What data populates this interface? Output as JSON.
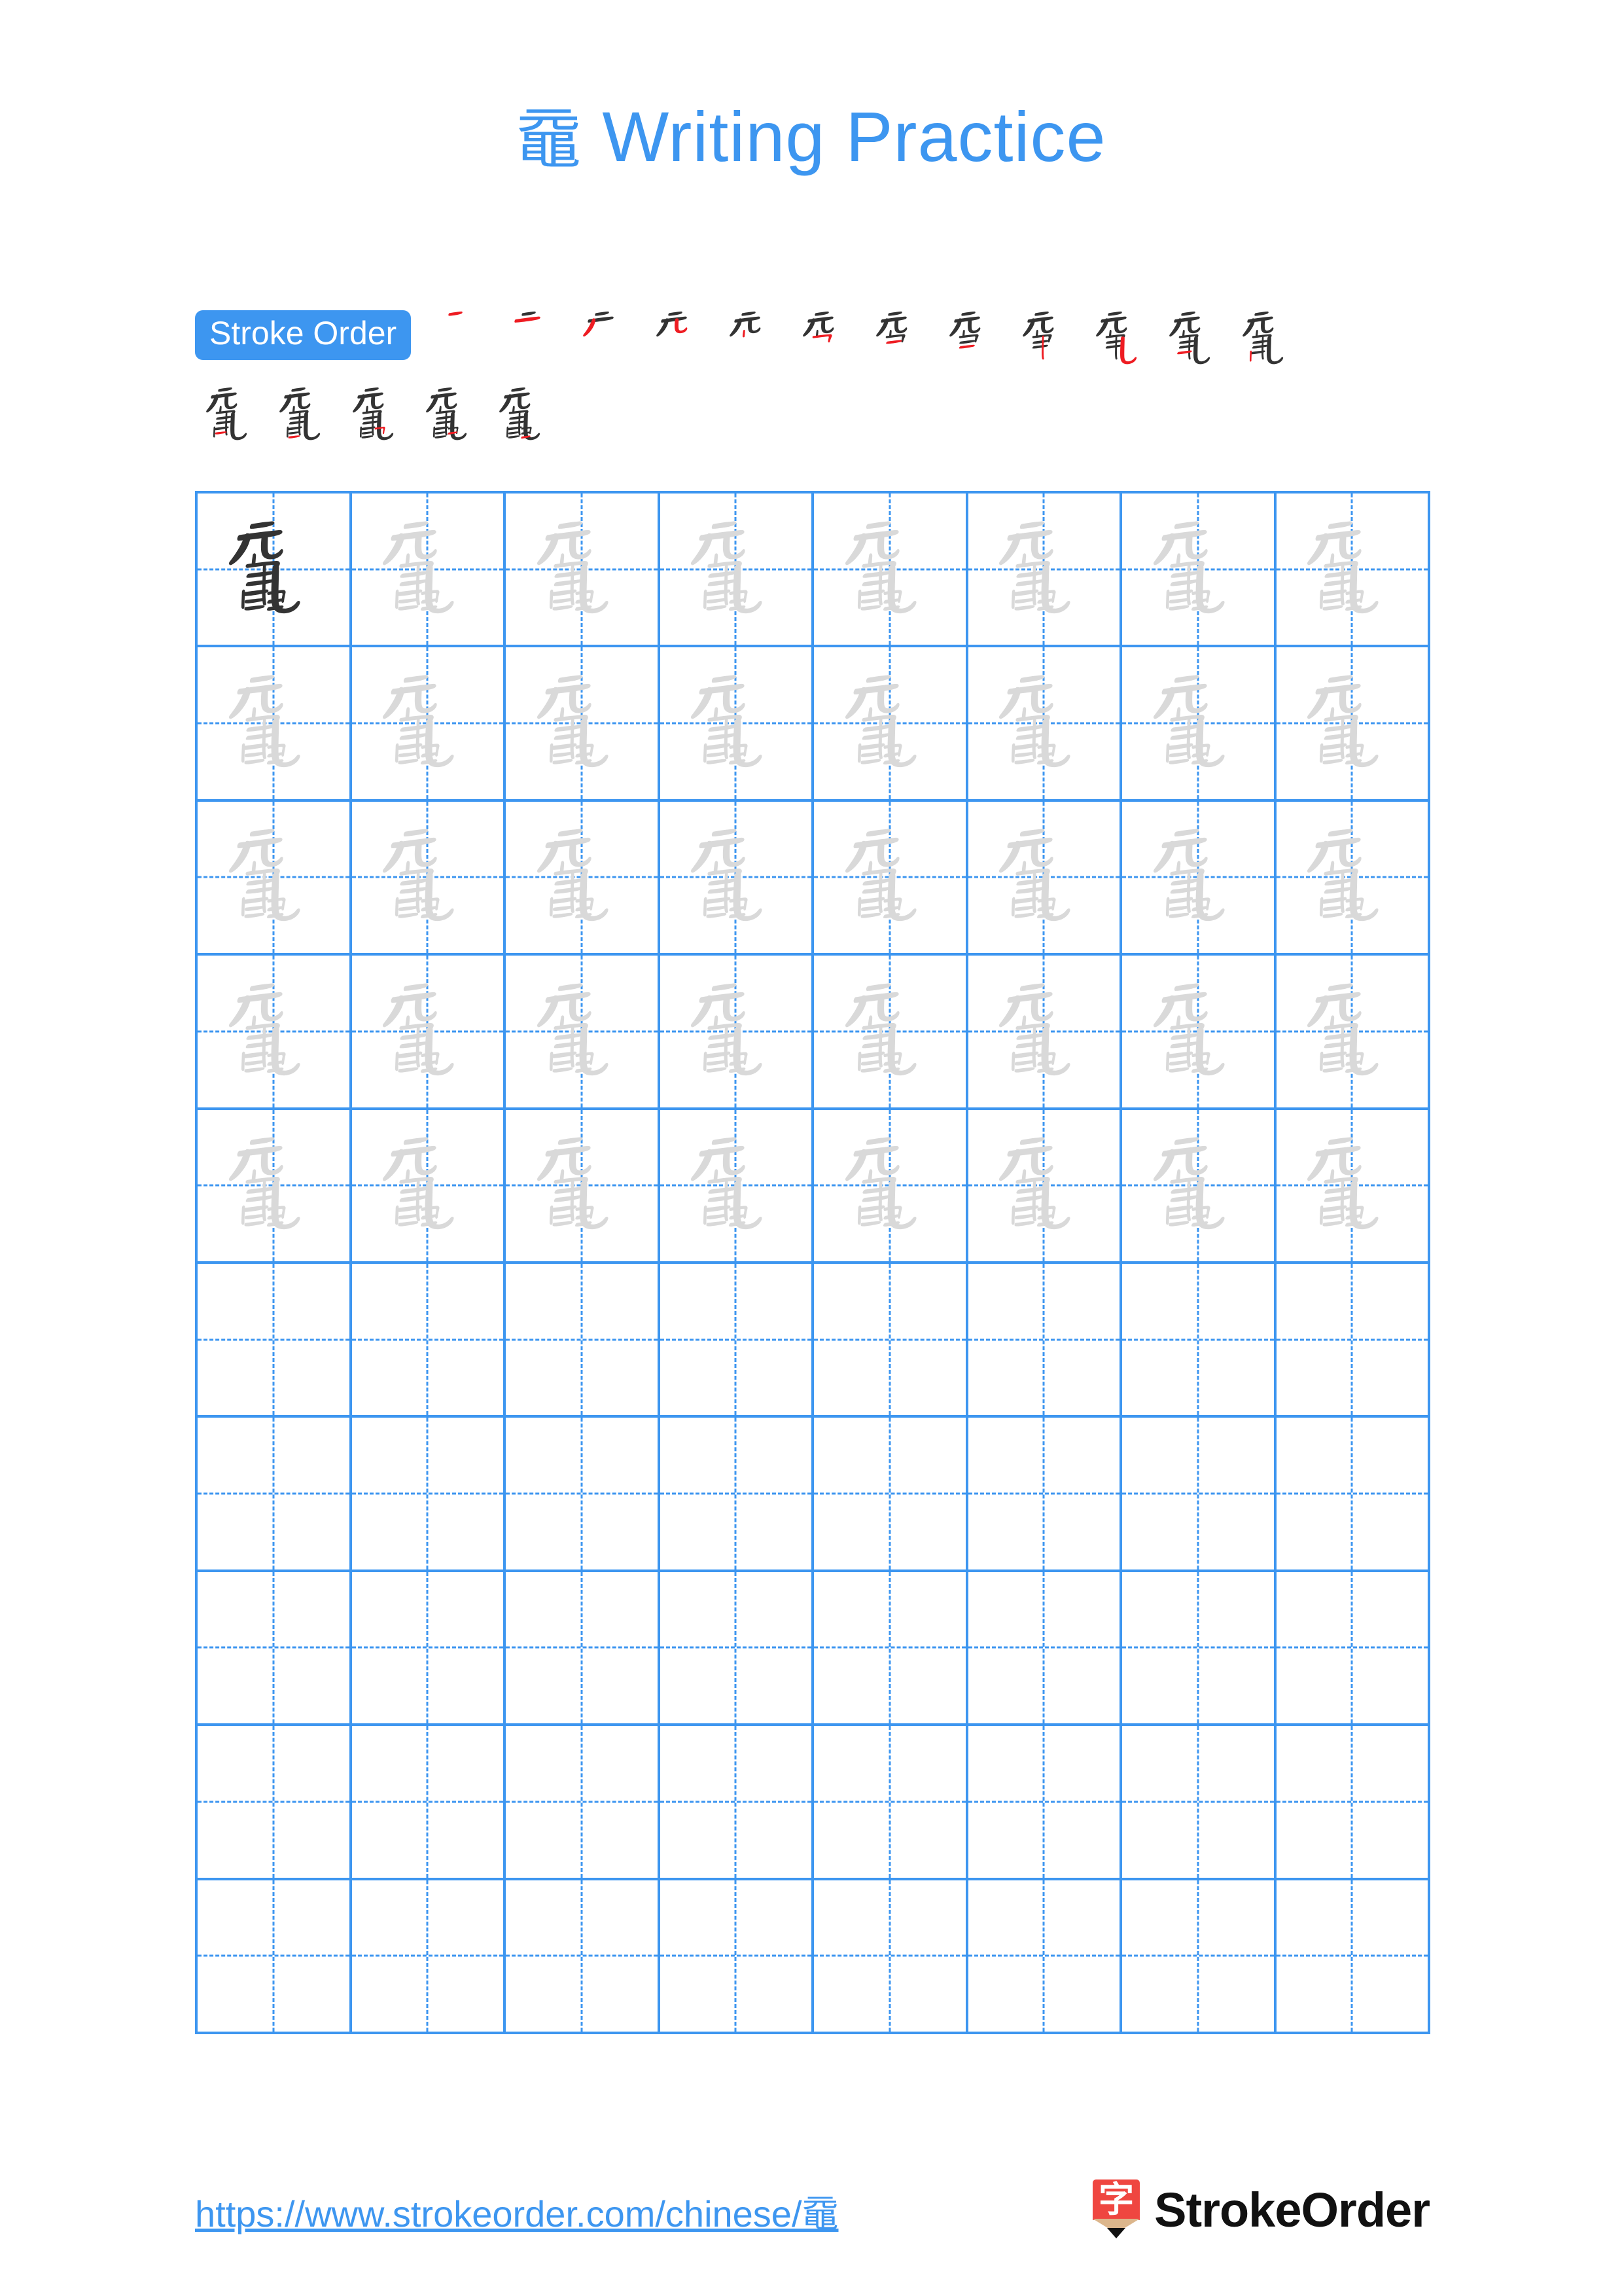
{
  "page": {
    "character": "黿",
    "title_suffix": " Writing Practice",
    "accent_color": "#3d96f0",
    "stroke_done_color": "#333333",
    "stroke_new_color": "#ee1c22",
    "watermark_color": "#d9d9d9"
  },
  "stroke_order": {
    "badge_label": "Stroke Order",
    "total_strokes": 17,
    "row1_count": 12,
    "row2_count": 5,
    "steps": [
      {
        "index": 1,
        "new_stroke": "横 (heng)"
      },
      {
        "index": 2,
        "new_stroke": "横 (heng)"
      },
      {
        "index": 3,
        "new_stroke": "撇 (pie)"
      },
      {
        "index": 4,
        "new_stroke": "竖弯钩 (shu wan gou)"
      },
      {
        "index": 5,
        "new_stroke": "竖 (shu)"
      },
      {
        "index": 6,
        "new_stroke": "横折 (heng zhe)"
      },
      {
        "index": 7,
        "new_stroke": "横 (heng)"
      },
      {
        "index": 8,
        "new_stroke": "横 (heng)"
      },
      {
        "index": 9,
        "new_stroke": "竖 (shu)"
      },
      {
        "index": 10,
        "new_stroke": "竖弯钩 (shu wan gou)"
      },
      {
        "index": 11,
        "new_stroke": "横 (heng)"
      },
      {
        "index": 12,
        "new_stroke": "竖 (shu)"
      },
      {
        "index": 13,
        "new_stroke": "横 (heng)"
      },
      {
        "index": 14,
        "new_stroke": "横 (heng)"
      },
      {
        "index": 15,
        "new_stroke": "横折 (heng zhe)"
      },
      {
        "index": 16,
        "new_stroke": "横 (heng)"
      },
      {
        "index": 17,
        "new_stroke": "横 (heng)"
      }
    ]
  },
  "practice_grid": {
    "columns": 8,
    "rows": 10,
    "traced_rows": 5,
    "model_cell_row": 1,
    "model_cell_column": 1,
    "empty_rows": 5,
    "cell_character": "黿"
  },
  "footer": {
    "url": "https://www.strokeorder.com/chinese/黿",
    "logo_glyph": "字",
    "logo_text": "StrokeOrder",
    "logo_color": "#ef4640"
  }
}
